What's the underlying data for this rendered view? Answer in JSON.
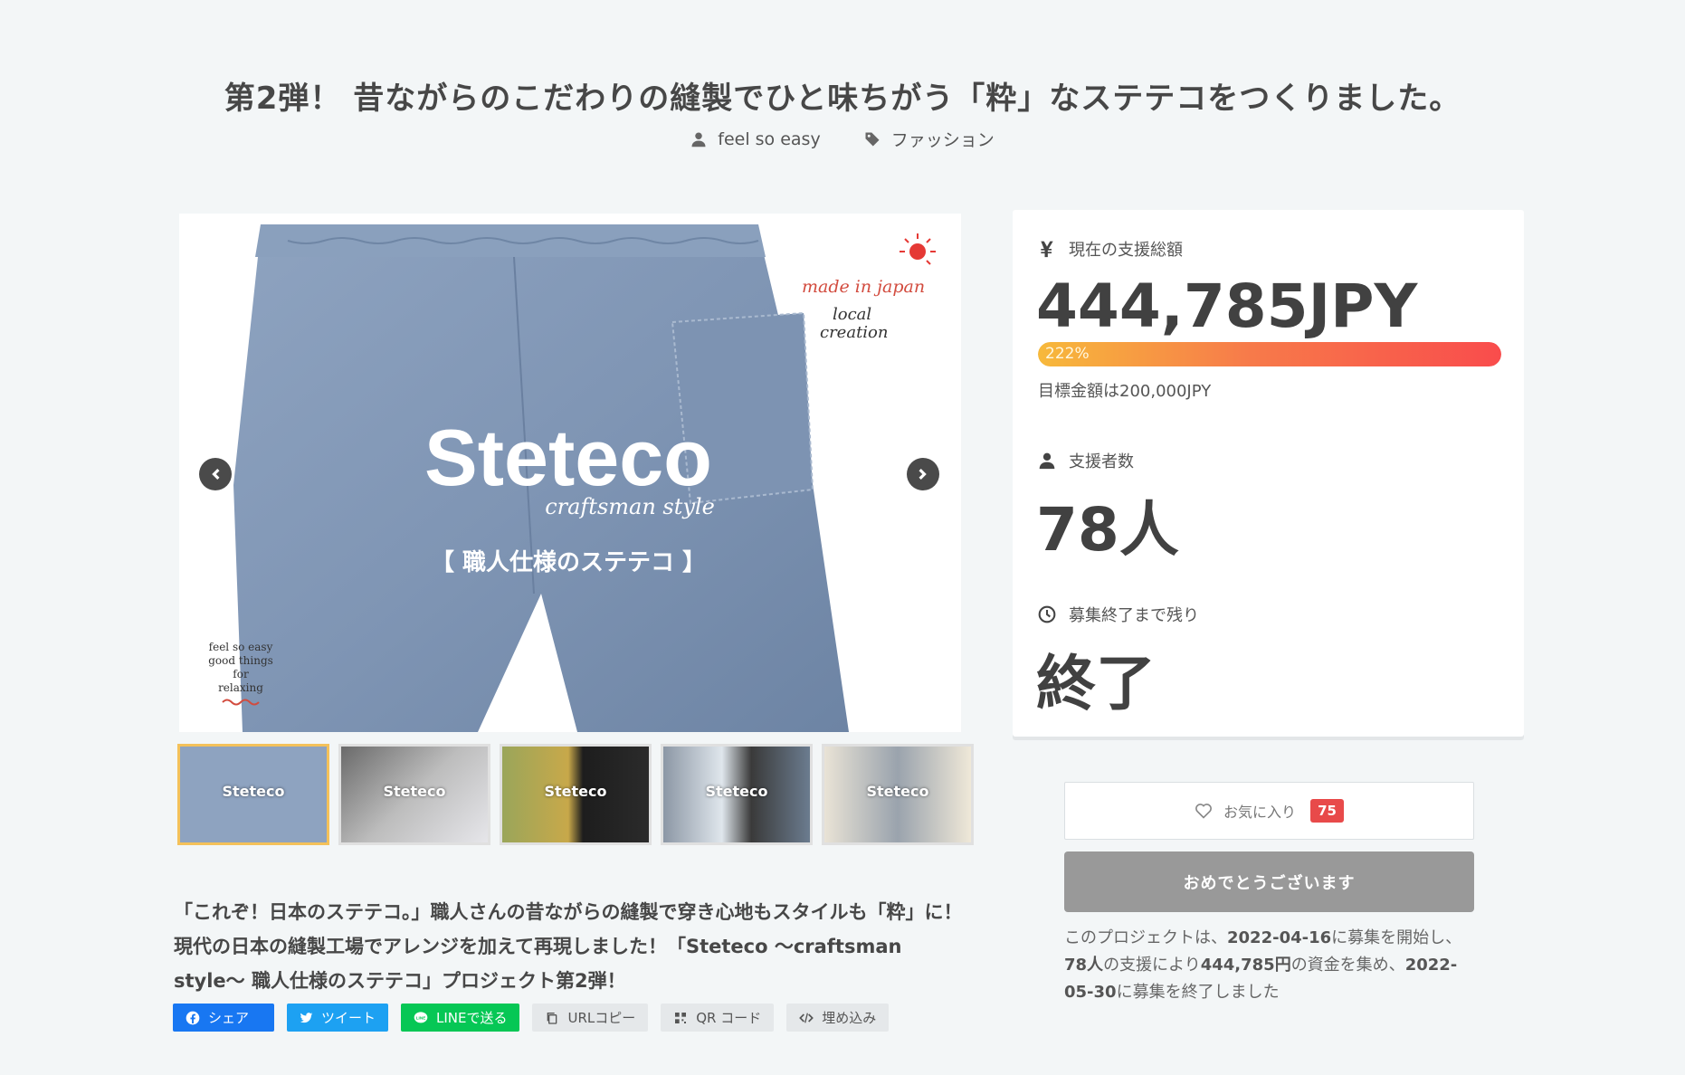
{
  "title": "第2弾！ 昔ながらのこだわりの縫製でひと味ちがう「粋」なステテコをつくりました。",
  "meta": {
    "author": "feel so easy",
    "category": "ファッション"
  },
  "image": {
    "brand": "Steteco",
    "tagline": "craftsman style",
    "subtitle": "【 職人仕様のステテコ 】",
    "made_in": "made in japan",
    "local_line1": "local",
    "local_line2": "creation",
    "corner_line1": "feel so easy",
    "corner_line2": "good things",
    "corner_line3": "for",
    "corner_line4": "relaxing",
    "thumb_label": "Steteco"
  },
  "description": "「これぞ！日本のステテコ。」職人さんの昔ながらの縫製で穿き心地もスタイルも「粋」に！ 現代の日本の縫製工場でアレンジを加えて再現しました！「Steteco 〜craftsman style〜 職人仕様のステテコ」プロジェクト第2弾！",
  "share": {
    "facebook": "シェア",
    "twitter": "ツイート",
    "line": "LINEで送る",
    "url_copy": "URLコピー",
    "qr": "QR コード",
    "embed": "埋め込み"
  },
  "stats": {
    "total_label": "現在の支援総額",
    "total_value": "444,785JPY",
    "percent_label": "222%",
    "percent": 222,
    "goal_text": "目標金額は200,000JPY",
    "backers_label": "支援者数",
    "backers_value": "78人",
    "remaining_label": "募集終了まで残り",
    "remaining_value": "終了"
  },
  "favorite": {
    "label": "お気に入り",
    "count": "75"
  },
  "status_button": "おめでとうございます",
  "summary": {
    "p1": "このプロジェクトは、",
    "start_date": "2022-04-16",
    "p2": "に募集を開始し、",
    "backers": "78人",
    "p3": "の支援により",
    "amount": "444,785円",
    "p4": "の資金を集め、",
    "end_date": "2022-05-30",
    "p5": "に募集を終了しました"
  },
  "colors": {
    "accent_red": "#e84a4a",
    "progress_start": "#f7b93b",
    "progress_end": "#f94c4c",
    "facebook": "#1877f2",
    "twitter": "#1da1f2",
    "line": "#06c755"
  }
}
